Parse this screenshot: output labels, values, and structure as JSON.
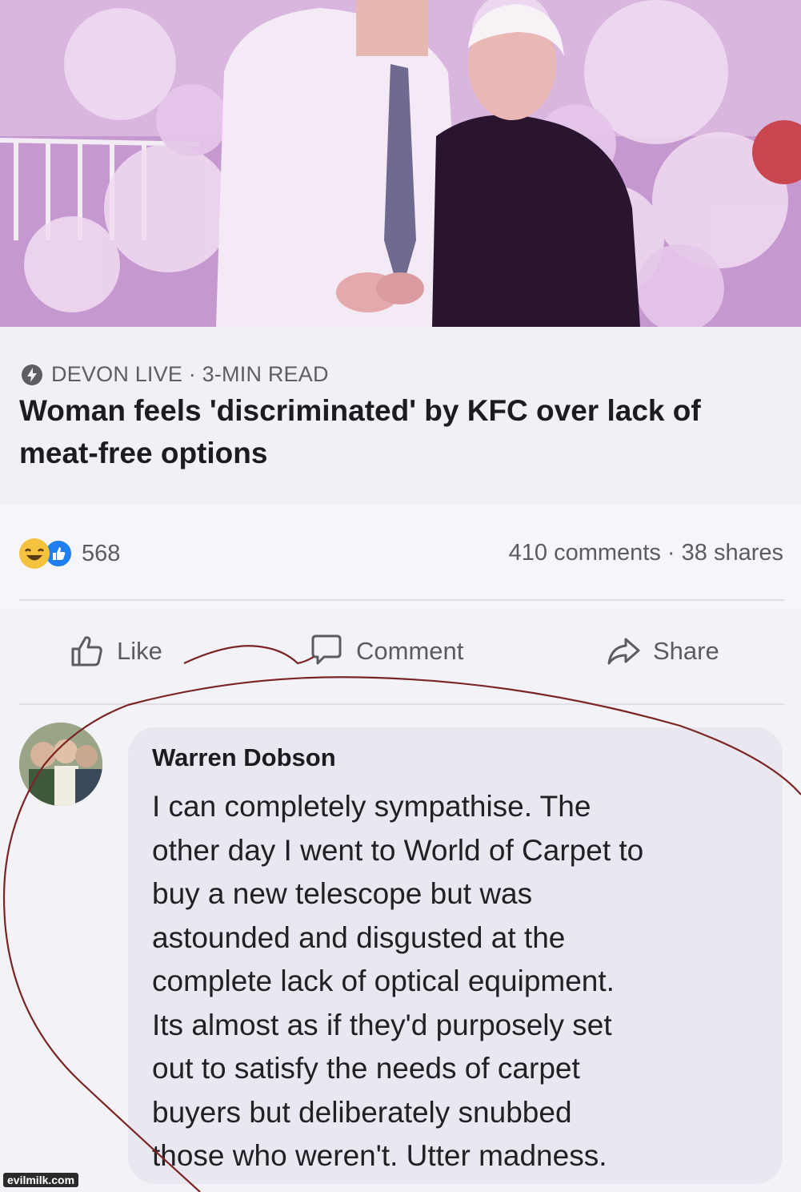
{
  "post": {
    "source": "DEVON LIVE · 3-MIN READ",
    "headline": "Woman feels 'discriminated' by KFC over lack of meat-free options"
  },
  "stats": {
    "reaction_count": "568",
    "comments_shares": "410 comments · 38 shares"
  },
  "actions": {
    "like": "Like",
    "comment": "Comment",
    "share": "Share"
  },
  "comment": {
    "author": "Warren Dobson",
    "text": "I can completely sympathise. The\nother day I went to World of Carpet to\nbuy a new telescope but was\nastounded and disgusted at the\ncomplete lack of optical equipment.\nIts almost as if they'd purposely set\nout to satisfy the needs of carpet\nbuyers but deliberately snubbed\nthose who weren't. Utter madness."
  },
  "watermark": "evilmilk.com",
  "colors": {
    "like_blue": "#1d7ff0",
    "haha_yellow": "#f4c23c",
    "annotation_red": "#7a2424"
  }
}
